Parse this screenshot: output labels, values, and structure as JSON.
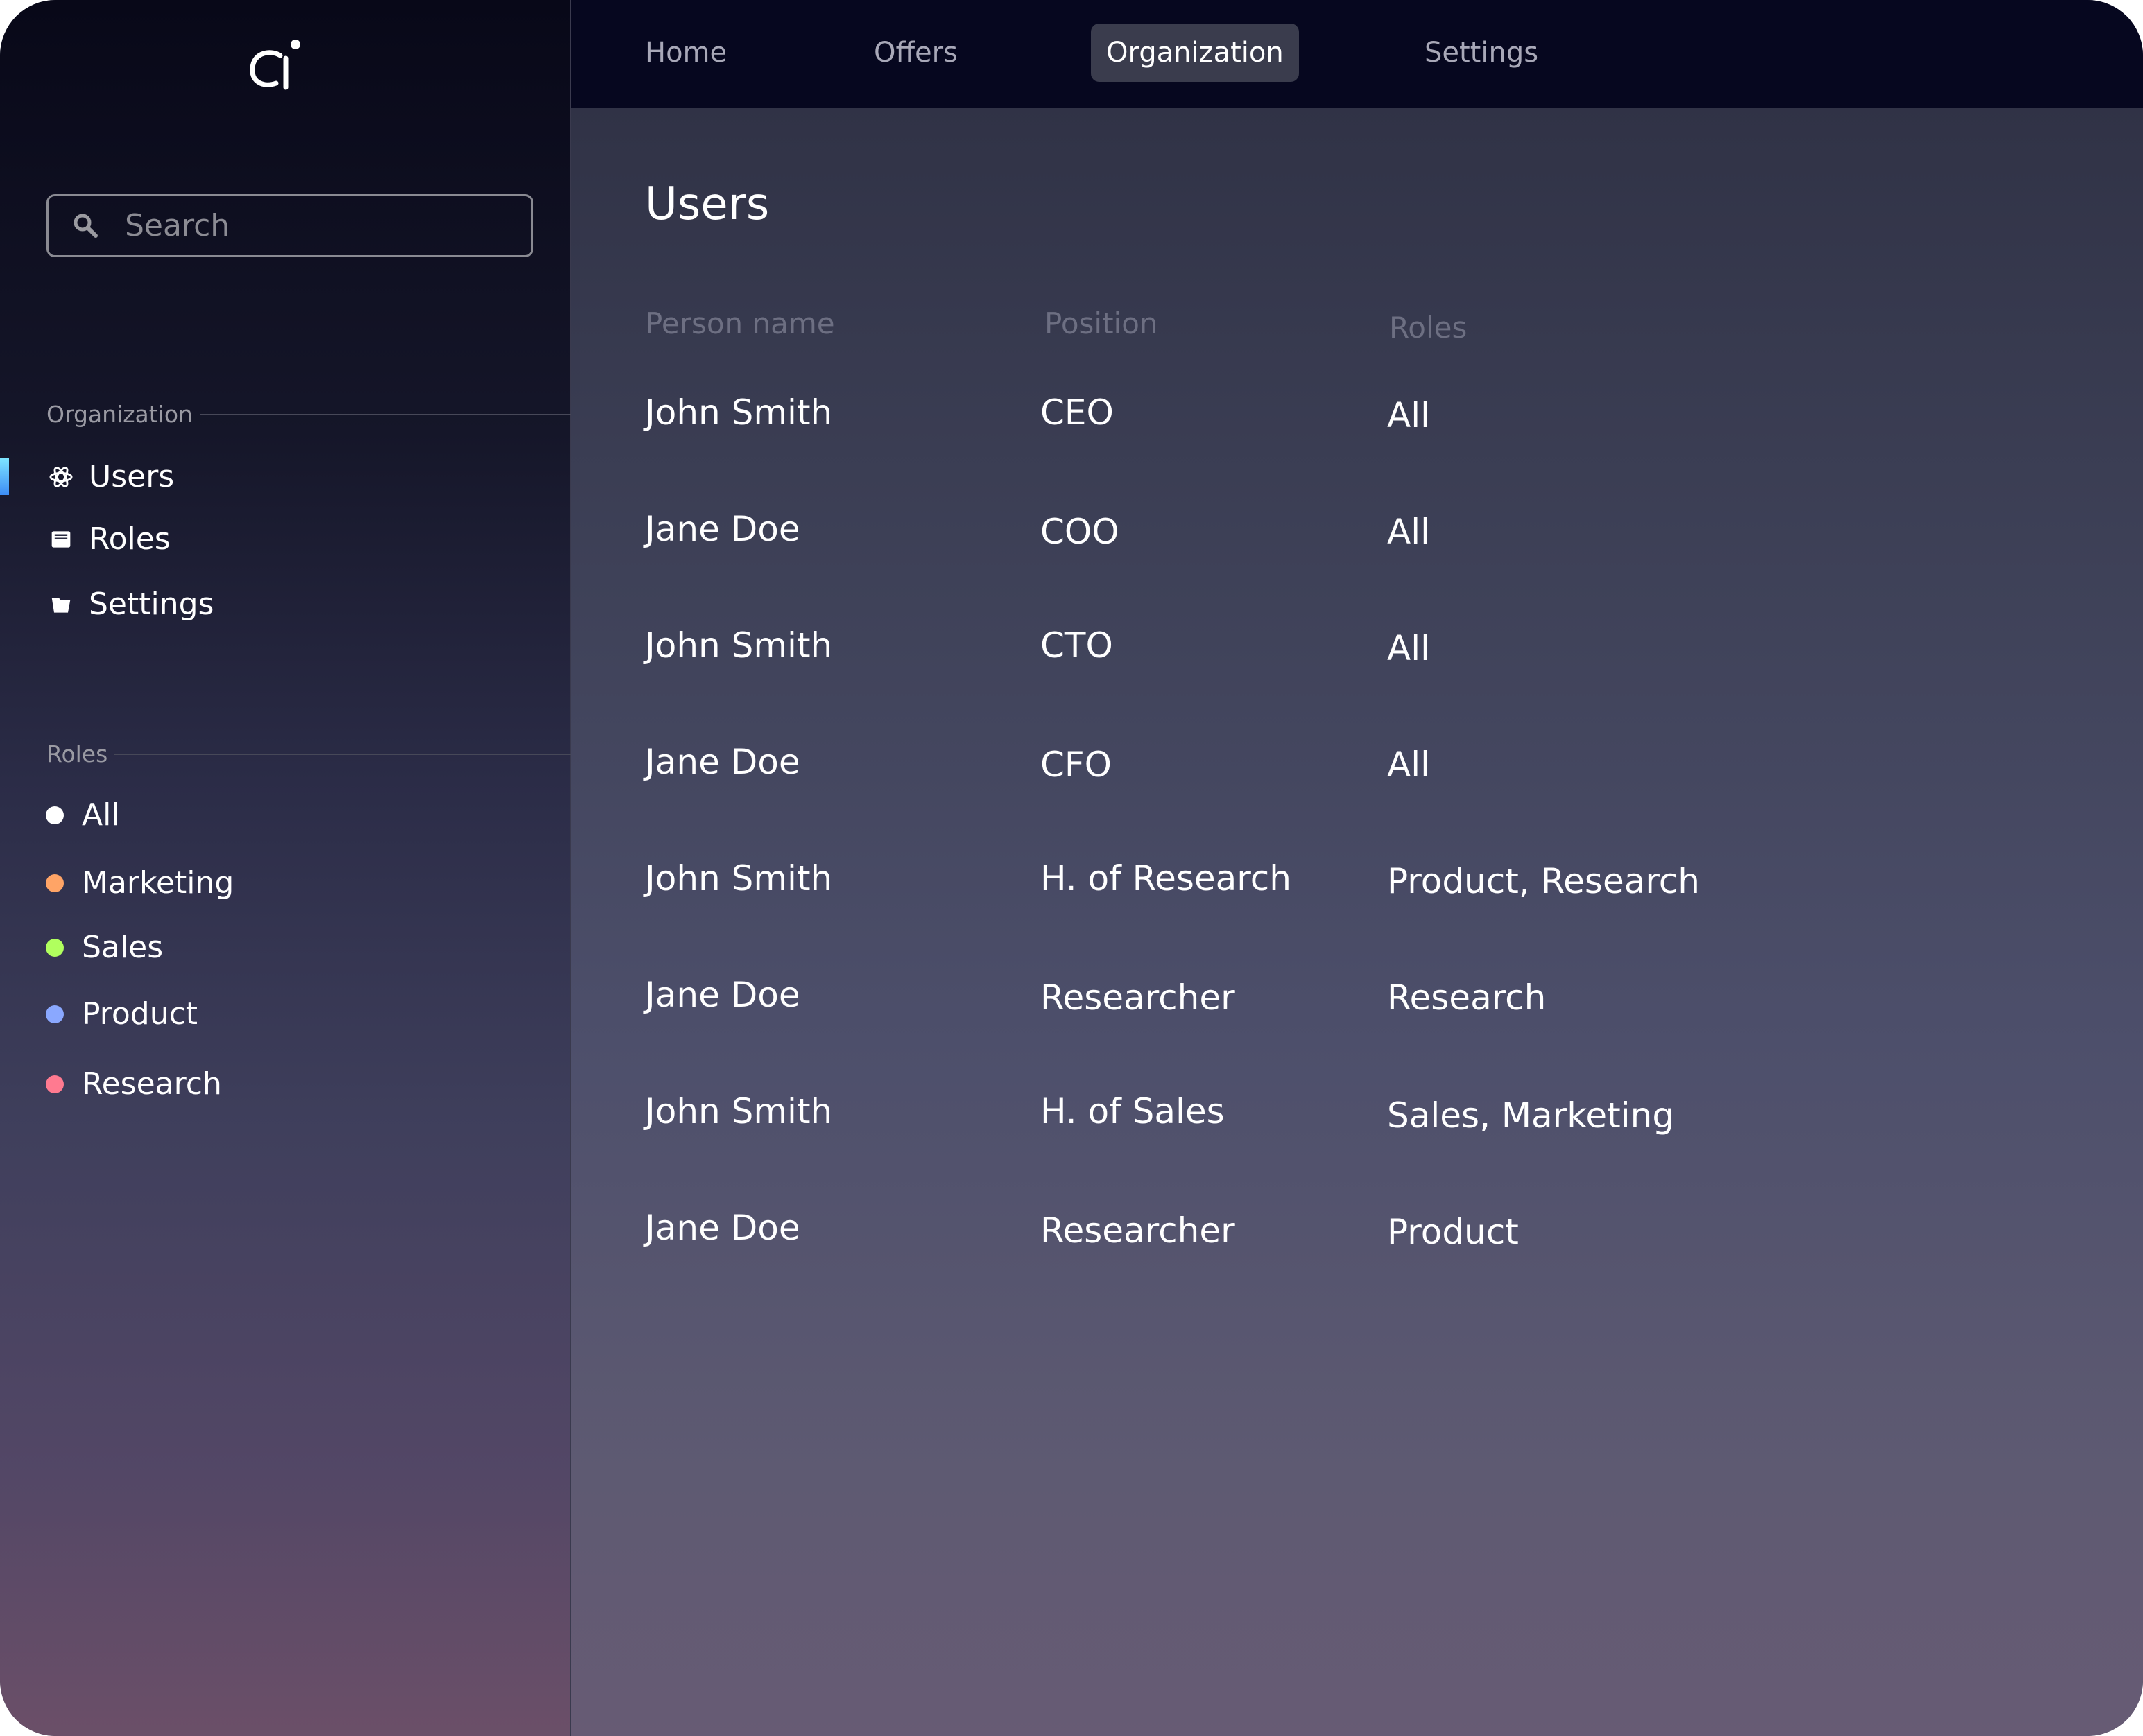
{
  "logo": "ai",
  "search": {
    "placeholder": "Search",
    "value": ""
  },
  "nav": {
    "tabs": [
      {
        "label": "Home"
      },
      {
        "label": "Offers"
      },
      {
        "label": "Organization",
        "active": true
      },
      {
        "label": "Settings"
      }
    ]
  },
  "sidebar": {
    "organization_label": "Organization",
    "items": [
      {
        "label": "Users",
        "icon": "atom-icon",
        "active": true
      },
      {
        "label": "Roles",
        "icon": "inbox-icon"
      },
      {
        "label": "Settings",
        "icon": "folder-icon"
      }
    ],
    "roles_label": "Roles",
    "roles": [
      {
        "label": "All",
        "color": "#ffffff"
      },
      {
        "label": "Marketing",
        "color": "#ffa466"
      },
      {
        "label": "Sales",
        "color": "#b0ff5e"
      },
      {
        "label": "Product",
        "color": "#8aa8ff"
      },
      {
        "label": "Research",
        "color": "#ff7a90"
      }
    ]
  },
  "main": {
    "title": "Users",
    "columns": [
      "Person name",
      "Position",
      "Roles"
    ],
    "rows": [
      {
        "name": "John Smith",
        "position": "CEO",
        "roles": "All"
      },
      {
        "name": "Jane Doe",
        "position": "COO",
        "roles": "All"
      },
      {
        "name": "John Smith",
        "position": "CTO",
        "roles": "All"
      },
      {
        "name": "Jane Doe",
        "position": "CFO",
        "roles": "All"
      },
      {
        "name": "John Smith",
        "position": "H. of Research",
        "roles": "Product, Research"
      },
      {
        "name": "Jane Doe",
        "position": "Researcher",
        "roles": "Research"
      },
      {
        "name": "John Smith",
        "position": "H. of Sales",
        "roles": "Sales, Marketing"
      },
      {
        "name": "Jane Doe",
        "position": "Researcher",
        "roles": "Product"
      }
    ]
  }
}
